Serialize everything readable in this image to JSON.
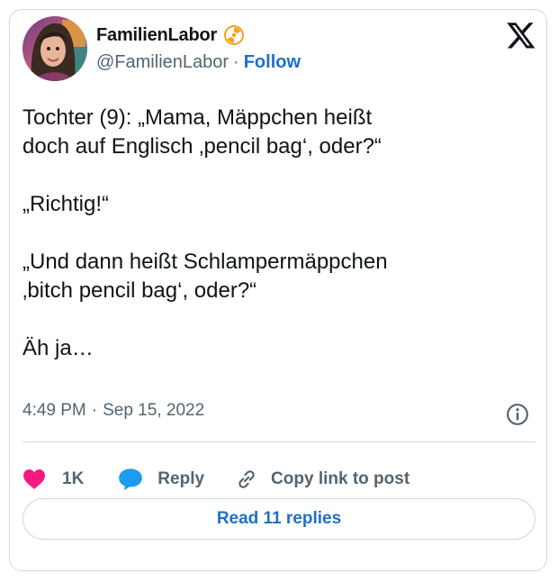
{
  "user": {
    "display_name": "FamilienLabor",
    "handle": "@FamilienLabor",
    "separator": "·",
    "follow_label": "Follow",
    "badge_icon": "radioactive-badge-icon"
  },
  "tweet": {
    "text": "Tochter (9): „Mama, Mäppchen heißt\ndoch auf Englisch ‚pencil bag‘, oder?“\n\n„Richtig!“\n\n„Und dann heißt Schlampermäppchen\n‚bitch pencil bag‘, oder?“\n\nÄh ja…",
    "time": "4:49 PM",
    "separator": "·",
    "date": "Sep 15, 2022"
  },
  "actions": {
    "likes": "1K",
    "reply_label": "Reply",
    "copy_label": "Copy link to post"
  },
  "read_replies_label": "Read 11 replies",
  "colors": {
    "accent": "#1d70c9",
    "like": "#f91880",
    "reply_bubble": "#1d9bf0",
    "secondary_text": "#536471",
    "badge": "#f6a01a"
  }
}
